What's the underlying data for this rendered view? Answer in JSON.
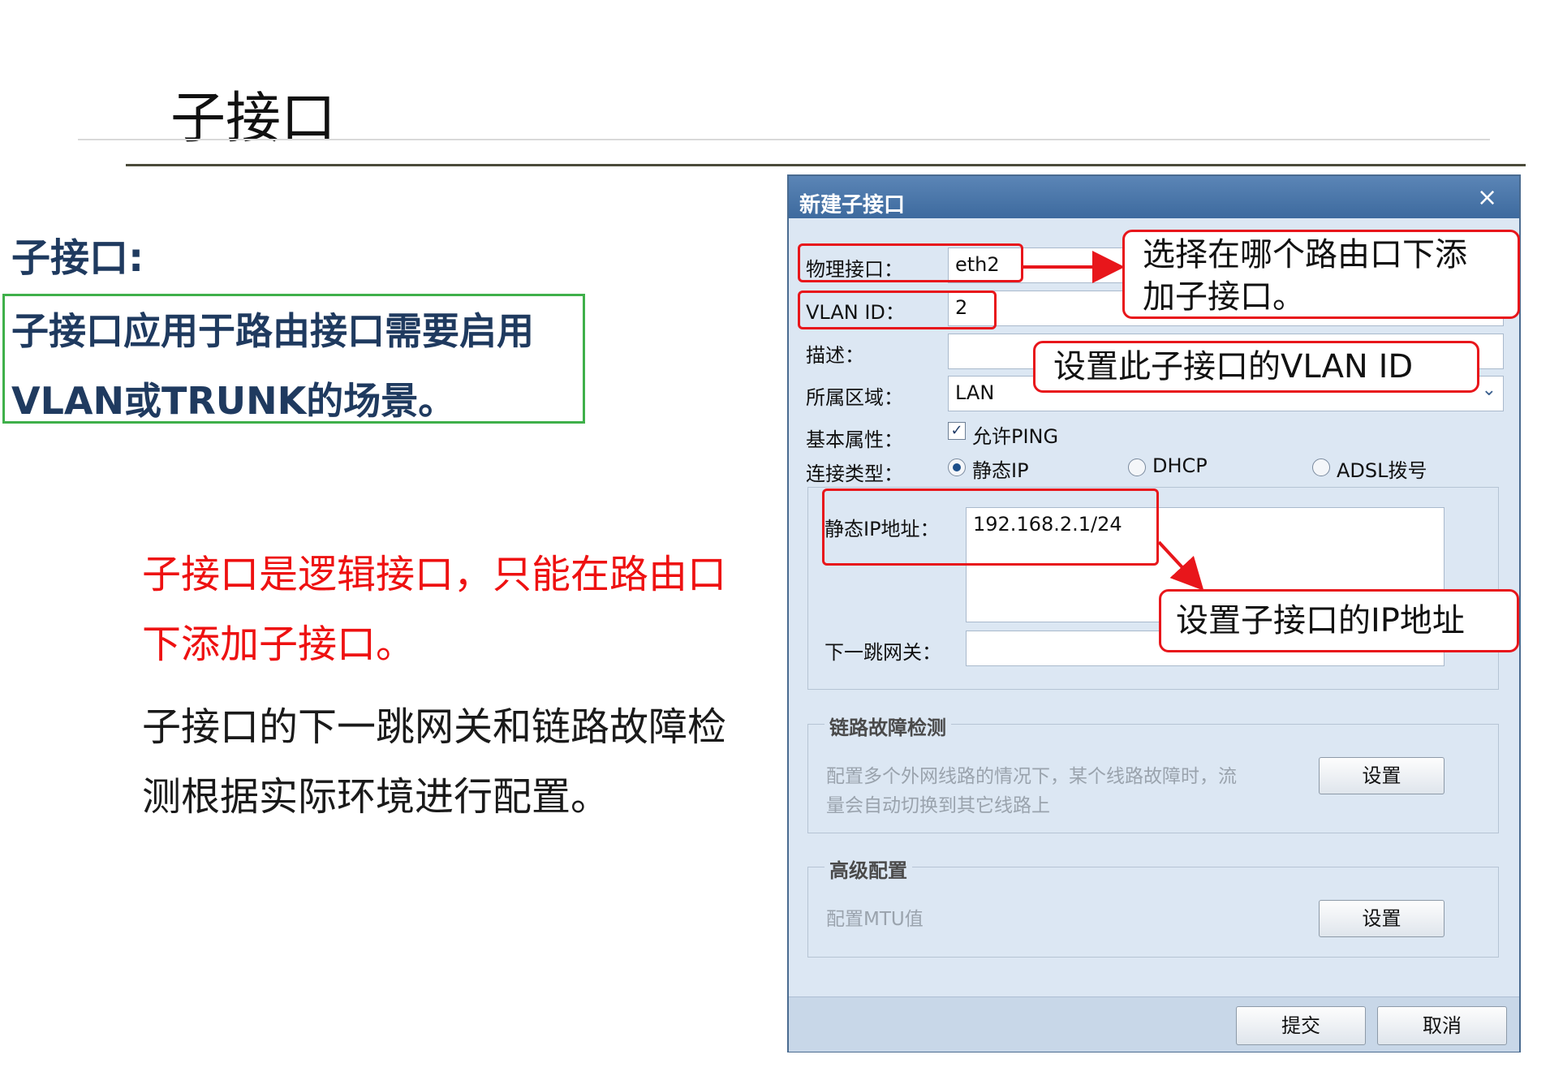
{
  "slide": {
    "title": "子接口",
    "heading": "子接口:",
    "green_lines": [
      "子接口应用于路由接口需要启用",
      "VLAN或TRUNK的场景。"
    ],
    "red_lines": [
      "子接口是逻辑接口，只能在路由口",
      "下添加子接口。"
    ],
    "black_lines": [
      "子接口的下一跳网关和链路故障检",
      "测根据实际环境进行配置。"
    ]
  },
  "dialog": {
    "title": "新建子接口",
    "close": "×",
    "fields": {
      "physical_label": "物理接口：",
      "physical_value": "eth2",
      "vlan_label": "VLAN ID：",
      "vlan_value": "2",
      "desc_label": "描述：",
      "desc_value": "",
      "zone_label": "所属区域：",
      "zone_value": "LAN",
      "basic_label": "基本属性：",
      "allow_ping": "允许PING",
      "allow_ping_checked": true,
      "conn_label": "连接类型：",
      "conn_options": [
        "静态IP",
        "DHCP",
        "ADSL拨号"
      ],
      "conn_selected": "静态IP",
      "static_ip_label": "静态IP地址：",
      "static_ip_value": "192.168.2.1/24",
      "gateway_label": "下一跳网关：",
      "gateway_value": ""
    },
    "link_check": {
      "legend": "链路故障检测",
      "desc_line1": "配置多个外网线路的情况下，某个线路故障时，流",
      "desc_line2": "量会自动切换到其它线路上",
      "button": "设置"
    },
    "advanced": {
      "legend": "高级配置",
      "desc": "配置MTU值",
      "button": "设置"
    },
    "footer": {
      "submit": "提交",
      "cancel": "取消"
    }
  },
  "annotations": {
    "callout_physical": [
      "选择在哪个路由口下添",
      "加子接口。"
    ],
    "callout_vlan": "设置此子接口的VLAN ID",
    "callout_ip": "设置子接口的IP地址",
    "color": "#e8161b"
  }
}
